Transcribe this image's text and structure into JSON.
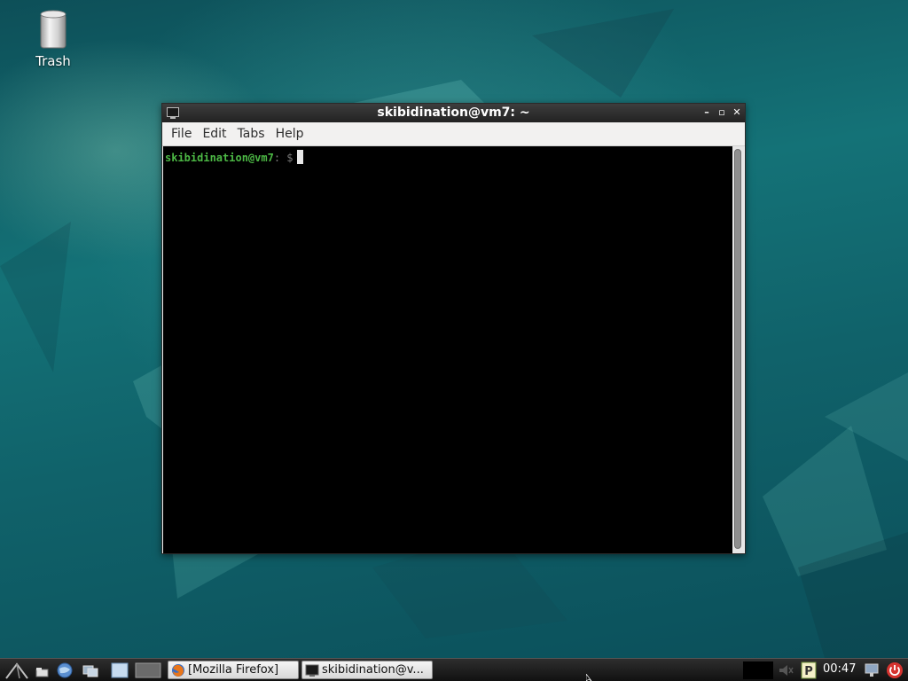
{
  "desktop": {
    "trash_label": "Trash"
  },
  "window": {
    "title": "skibidination@vm7: ~",
    "menu": [
      "File",
      "Edit",
      "Tabs",
      "Help"
    ],
    "controls": {
      "minimize": "–",
      "maximize": "▫",
      "close": "✕"
    }
  },
  "terminal": {
    "prompt_user": "skibidination@vm7",
    "prompt_sep": ": ",
    "prompt_symbol": "$"
  },
  "taskbar": {
    "tasks": [
      {
        "label": "[Mozilla Firefox]",
        "icon": "firefox-icon"
      },
      {
        "label": "skibidination@v...",
        "icon": "terminal-icon"
      }
    ],
    "clock": "00:47"
  },
  "colors": {
    "prompt_green": "#4cb845",
    "terminal_bg": "#000000",
    "titlebar": "#2b2b2b",
    "desktop_teal": "#147277"
  }
}
